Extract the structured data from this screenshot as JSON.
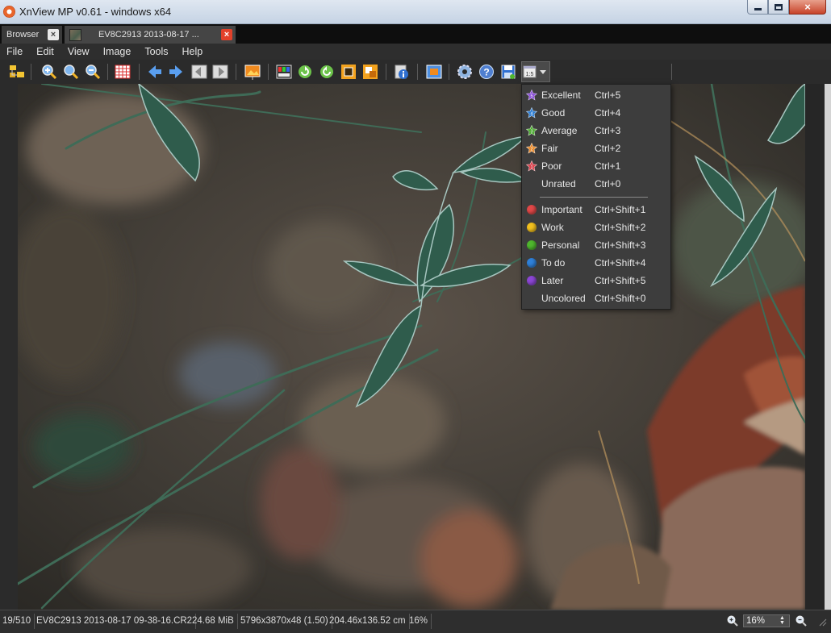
{
  "window": {
    "title": "XnView MP v0.61 - windows x64",
    "minimize": "minimize",
    "maximize": "maximize",
    "close": "×"
  },
  "tabs": [
    {
      "label": "Browser",
      "close": "×"
    },
    {
      "label": "EV8C2913 2013-08-17 ...",
      "close": "×"
    }
  ],
  "menu": [
    "File",
    "Edit",
    "View",
    "Image",
    "Tools",
    "Help"
  ],
  "toolbar_icons": [
    "browser-icon",
    "zoom-in-icon",
    "zoom-fit-icon",
    "zoom-out-icon",
    "grid-icon",
    "previous-icon",
    "next-icon",
    "first-icon",
    "last-icon",
    "slideshow-icon",
    "adjust-icon",
    "rotate-left-icon",
    "rotate-right-icon",
    "crop-icon",
    "resize-icon",
    "info-icon",
    "fullscreen-icon",
    "settings-icon",
    "help-icon",
    "save-icon",
    "rating-icon"
  ],
  "rating_menu": {
    "ratings": [
      {
        "label": "Excellent",
        "shortcut": "Ctrl+5",
        "color": "#8a4fd6",
        "icon": "star-icon"
      },
      {
        "label": "Good",
        "shortcut": "Ctrl+4",
        "color": "#2f7fd4",
        "icon": "star-icon"
      },
      {
        "label": "Average",
        "shortcut": "Ctrl+3",
        "color": "#4aa82f",
        "icon": "star-icon"
      },
      {
        "label": "Fair",
        "shortcut": "Ctrl+2",
        "color": "#e8892a",
        "icon": "star-icon"
      },
      {
        "label": "Poor",
        "shortcut": "Ctrl+1",
        "color": "#d9434d",
        "icon": "star-icon"
      },
      {
        "label": "Unrated",
        "shortcut": "Ctrl+0",
        "color": "",
        "icon": ""
      }
    ],
    "colors": [
      {
        "label": "Important",
        "shortcut": "Ctrl+Shift+1",
        "color": "#e04848"
      },
      {
        "label": "Work",
        "shortcut": "Ctrl+Shift+2",
        "color": "#f2c01e"
      },
      {
        "label": "Personal",
        "shortcut": "Ctrl+Shift+3",
        "color": "#4fb62e"
      },
      {
        "label": "To do",
        "shortcut": "Ctrl+Shift+4",
        "color": "#2f80d8"
      },
      {
        "label": "Later",
        "shortcut": "Ctrl+Shift+5",
        "color": "#8b46d4"
      },
      {
        "label": "Uncolored",
        "shortcut": "Ctrl+Shift+0",
        "color": ""
      }
    ]
  },
  "status": {
    "position": "19/510",
    "filename": "EV8C2913 2013-08-17 09-38-16.CR2",
    "filesize": "24.68 MiB",
    "dimensions": "5796x3870x48 (1.50)",
    "print_size": "204.46x136.52 cm",
    "zoom": "16%",
    "zoom_select": "16%"
  }
}
